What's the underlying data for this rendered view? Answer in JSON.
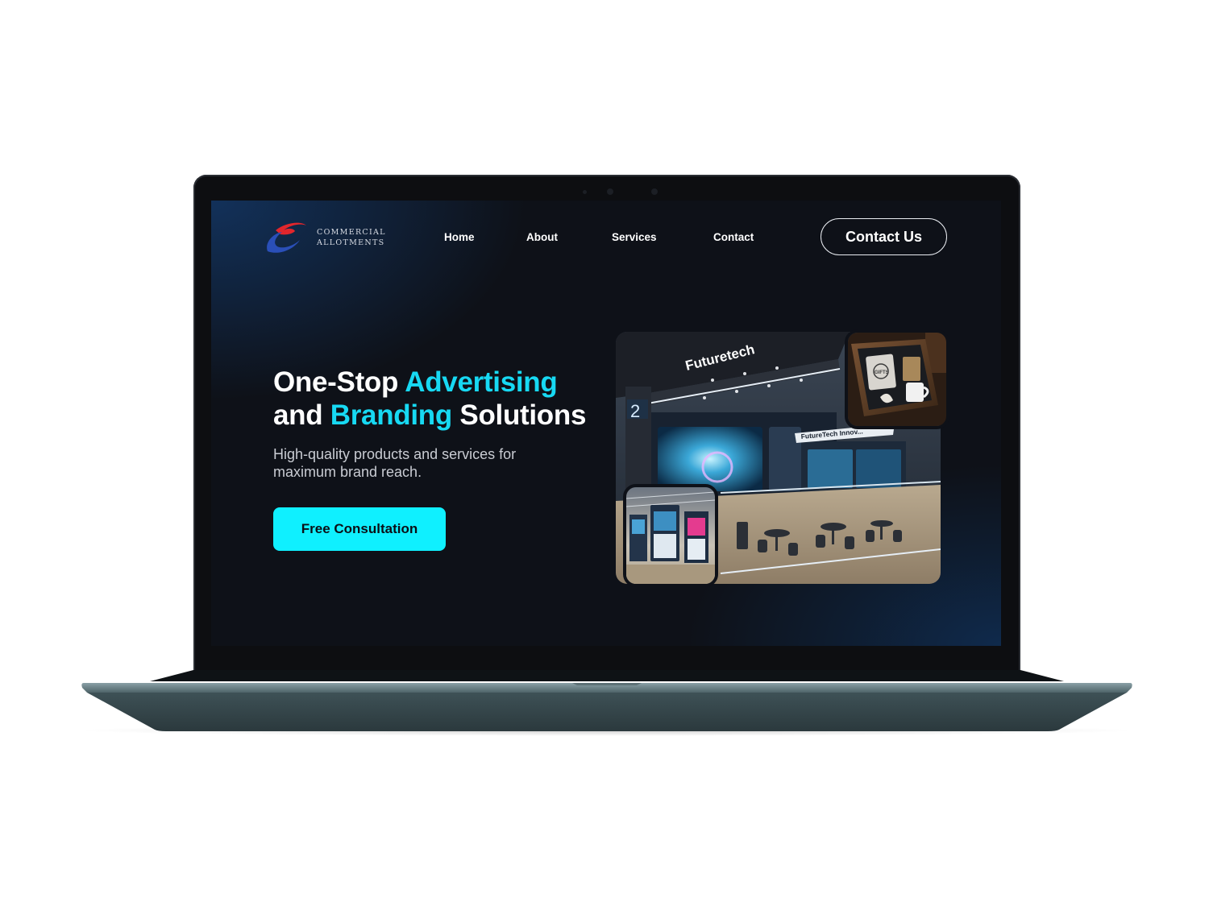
{
  "brand": {
    "line1": "COMMERCIAL",
    "line2": "ALLOTMENTS",
    "colors": {
      "red": "#e2262c",
      "blue": "#2a4fb8"
    }
  },
  "nav": {
    "items": [
      {
        "label": "Home"
      },
      {
        "label": "About"
      },
      {
        "label": "Services"
      },
      {
        "label": "Contact"
      }
    ],
    "cta_label": "Contact Us"
  },
  "hero": {
    "title_part1": "One-Stop ",
    "title_accent1": "Advertising",
    "title_part2": "and ",
    "title_accent2": "Branding",
    "title_part3": " Solutions",
    "subtitle": "High-quality products and services for maximum brand reach.",
    "cta_label": "Free Consultation",
    "accent_color": "#17d9f3",
    "button_color": "#0ff0ff"
  },
  "collage": {
    "booth_sign": "Futuretech",
    "booth_banner": "FutureTech Innov...",
    "booth_number": "2",
    "gift_label": "GIFTS"
  },
  "theme": {
    "background": "#0e1118",
    "text": "#ffffff"
  }
}
